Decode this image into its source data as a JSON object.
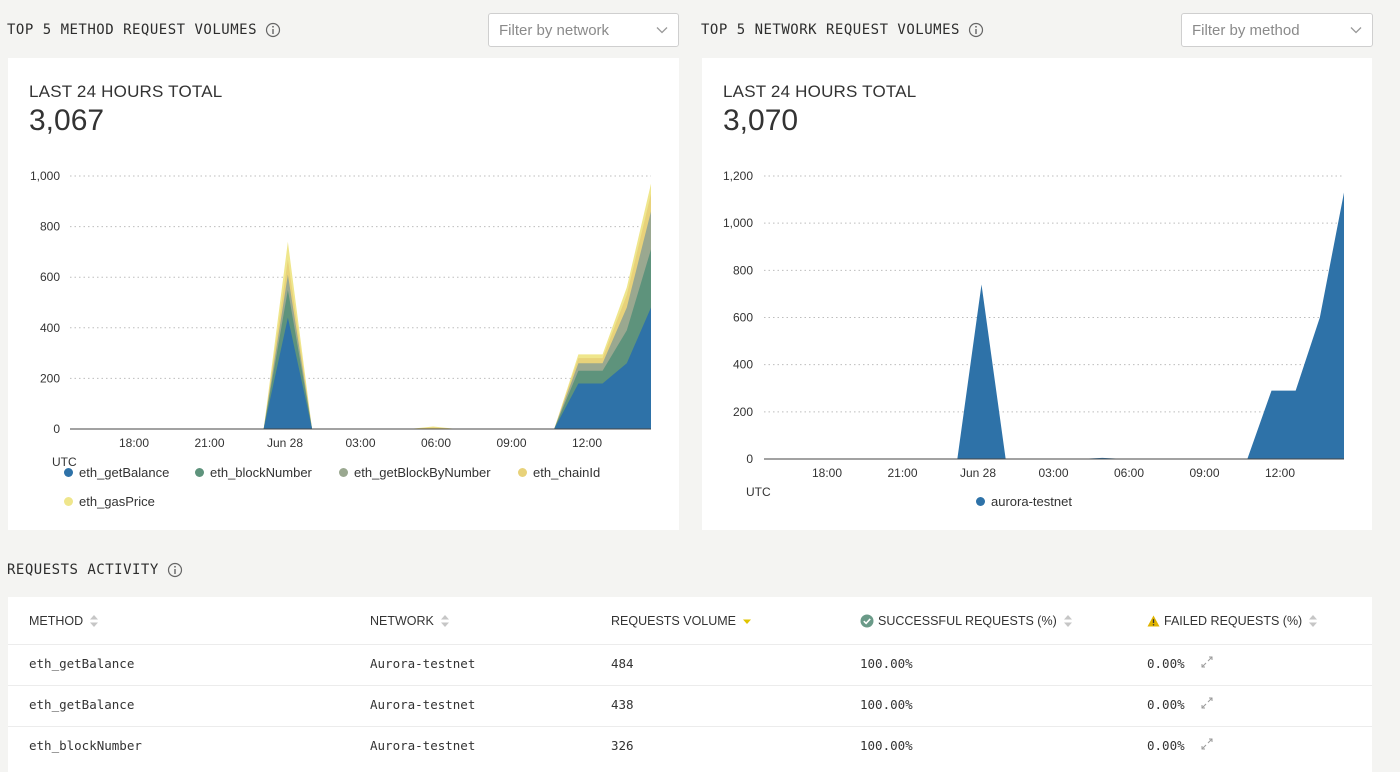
{
  "left_panel": {
    "title": "TOP 5 METHOD REQUEST VOLUMES",
    "filter_placeholder": "Filter by network",
    "total_label": "LAST 24 HOURS TOTAL",
    "total_value": "3,067",
    "timezone": "UTC",
    "legend": [
      "eth_getBalance",
      "eth_blockNumber",
      "eth_getBlockByNumber",
      "eth_chainId",
      "eth_gasPrice"
    ]
  },
  "right_panel": {
    "title": "TOP 5 NETWORK REQUEST VOLUMES",
    "filter_placeholder": "Filter by method",
    "total_label": "LAST 24 HOURS TOTAL",
    "total_value": "3,070",
    "timezone": "UTC",
    "legend": [
      "aurora-testnet"
    ]
  },
  "activity": {
    "title": "REQUESTS ACTIVITY",
    "columns": [
      "METHOD",
      "NETWORK",
      "REQUESTS VOLUME",
      "SUCCESSFUL REQUESTS (%)",
      "FAILED REQUESTS (%)"
    ],
    "rows": [
      [
        "eth_getBalance",
        "Aurora-testnet",
        "484",
        "100.00%",
        "0.00%"
      ],
      [
        "eth_getBalance",
        "Aurora-testnet",
        "438",
        "100.00%",
        "0.00%"
      ],
      [
        "eth_blockNumber",
        "Aurora-testnet",
        "326",
        "100.00%",
        "0.00%"
      ]
    ]
  },
  "colors": {
    "eth_getBalance": "#2e72a8",
    "eth_blockNumber": "#5e937c",
    "eth_getBlockByNumber": "#9aa890",
    "eth_chainId": "#e8d27a",
    "eth_gasPrice": "#efe68c",
    "aurora-testnet": "#2e72a8",
    "success_icon": "#6a9a88",
    "warning_icon": "#e0b400"
  },
  "chart_data": [
    {
      "type": "area",
      "stacked": true,
      "x": [
        "15:00",
        "16:00",
        "17:00",
        "18:00",
        "19:00",
        "20:00",
        "21:00",
        "22:00",
        "23:00",
        "Jun 28 00:00",
        "01:00",
        "02:00",
        "03:00",
        "04:00",
        "05:00",
        "06:00",
        "07:00",
        "08:00",
        "09:00",
        "10:00",
        "11:00",
        "12:00",
        "13:00",
        "14:00"
      ],
      "x_ticks": [
        "18:00",
        "21:00",
        "Jun 28",
        "03:00",
        "06:00",
        "09:00",
        "12:00"
      ],
      "xlabel": "UTC",
      "ylim": [
        0,
        1000
      ],
      "y_ticks": [
        0,
        200,
        400,
        600,
        800,
        "1,000"
      ],
      "grid": true,
      "legend_position": "bottom-left",
      "series": [
        {
          "name": "eth_getBalance",
          "values": [
            0,
            0,
            0,
            0,
            0,
            0,
            0,
            0,
            0,
            440,
            0,
            0,
            0,
            0,
            0,
            0,
            0,
            0,
            0,
            0,
            0,
            180,
            180,
            260,
            480
          ]
        },
        {
          "name": "eth_blockNumber",
          "values": [
            0,
            0,
            0,
            0,
            0,
            0,
            0,
            0,
            0,
            110,
            0,
            0,
            0,
            0,
            0,
            0,
            0,
            0,
            0,
            0,
            0,
            50,
            50,
            130,
            230
          ]
        },
        {
          "name": "eth_getBlockByNumber",
          "values": [
            0,
            0,
            0,
            0,
            0,
            0,
            0,
            0,
            0,
            60,
            0,
            0,
            0,
            0,
            0,
            0,
            0,
            0,
            0,
            0,
            0,
            30,
            30,
            90,
            150
          ]
        },
        {
          "name": "eth_chainId",
          "values": [
            0,
            0,
            0,
            0,
            0,
            0,
            0,
            0,
            0,
            60,
            0,
            0,
            0,
            0,
            0,
            6,
            0,
            0,
            0,
            0,
            0,
            20,
            20,
            50,
            70
          ]
        },
        {
          "name": "eth_gasPrice",
          "values": [
            0,
            0,
            0,
            0,
            0,
            0,
            0,
            0,
            0,
            70,
            0,
            0,
            0,
            0,
            0,
            4,
            0,
            0,
            0,
            0,
            0,
            15,
            15,
            30,
            40
          ]
        }
      ]
    },
    {
      "type": "area",
      "x": [
        "15:00",
        "16:00",
        "17:00",
        "18:00",
        "19:00",
        "20:00",
        "21:00",
        "22:00",
        "23:00",
        "Jun 28 00:00",
        "01:00",
        "02:00",
        "03:00",
        "04:00",
        "05:00",
        "06:00",
        "07:00",
        "08:00",
        "09:00",
        "10:00",
        "11:00",
        "12:00",
        "13:00",
        "14:00"
      ],
      "x_ticks": [
        "18:00",
        "21:00",
        "Jun 28",
        "03:00",
        "06:00",
        "09:00",
        "12:00"
      ],
      "xlabel": "UTC",
      "ylim": [
        0,
        1200
      ],
      "y_ticks": [
        0,
        200,
        400,
        600,
        800,
        "1,000",
        "1,200"
      ],
      "grid": true,
      "legend_position": "bottom-center",
      "series": [
        {
          "name": "aurora-testnet",
          "values": [
            0,
            0,
            0,
            0,
            0,
            0,
            0,
            0,
            0,
            740,
            0,
            0,
            0,
            0,
            5,
            0,
            0,
            0,
            0,
            0,
            0,
            290,
            290,
            600,
            1130
          ]
        }
      ]
    }
  ]
}
